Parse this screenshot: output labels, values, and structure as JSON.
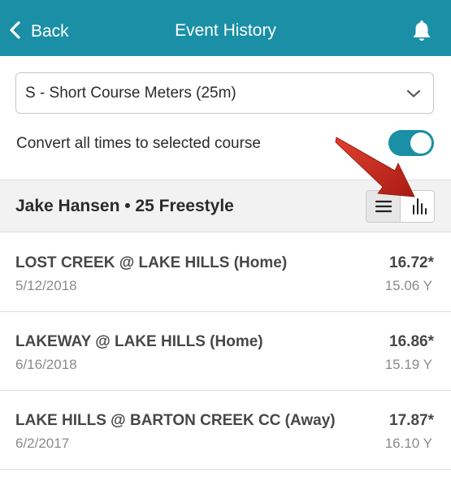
{
  "header": {
    "back_label": "Back",
    "title": "Event History",
    "icons": {
      "back": "chevron-left-icon",
      "notifications": "bell-icon"
    },
    "background_color": "#1a8fa5"
  },
  "course_select": {
    "value": "S - Short Course Meters (25m)",
    "icon": "chevron-down-icon"
  },
  "convert": {
    "label": "Convert all times to selected course",
    "enabled": true,
    "toggle_color": "#1a8fa5"
  },
  "event_header": {
    "title": "Jake Hansen • 25 Freestyle",
    "view_modes": [
      {
        "name": "list",
        "icon": "list-icon",
        "selected": true
      },
      {
        "name": "chart",
        "icon": "bar-chart-icon",
        "selected": false
      }
    ]
  },
  "annotation": {
    "icon": "red-arrow-icon",
    "color": "#c8281e"
  },
  "swims": [
    {
      "meet": "LOST CREEK @ LAKE HILLS (Home)",
      "date": "5/12/2018",
      "time": "16.72*",
      "converted": "15.06 Y"
    },
    {
      "meet": "LAKEWAY @ LAKE HILLS (Home)",
      "date": "6/16/2018",
      "time": "16.86*",
      "converted": "15.19 Y"
    },
    {
      "meet": "LAKE HILLS @ BARTON CREEK CC (Away)",
      "date": "6/2/2017",
      "time": "17.87*",
      "converted": "16.10 Y"
    }
  ]
}
